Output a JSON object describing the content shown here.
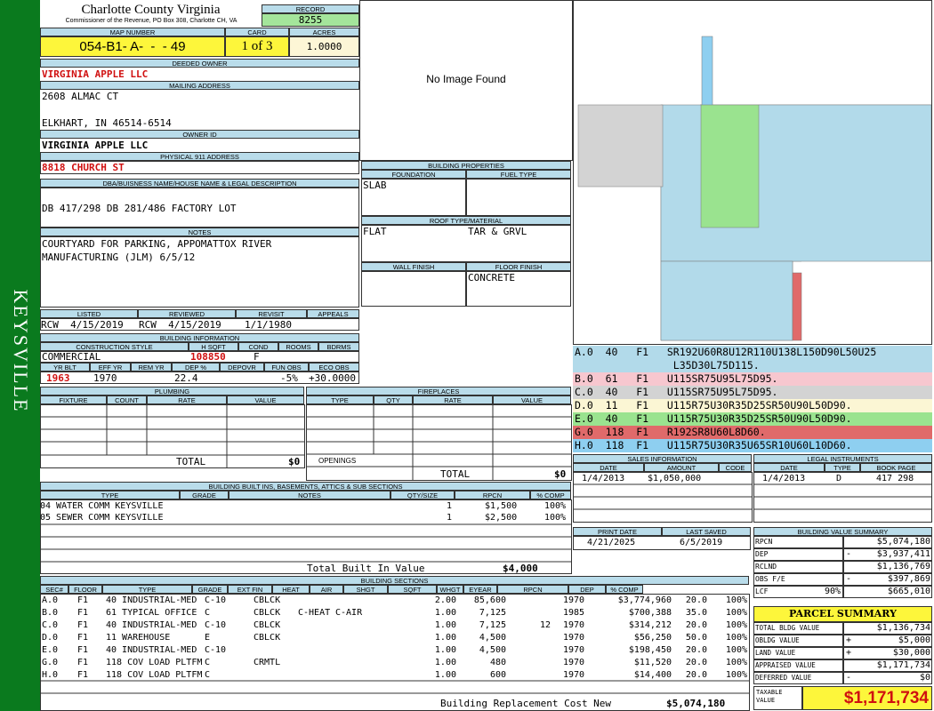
{
  "sidebar": {
    "label": "KEYSVILLE"
  },
  "header": {
    "county": "Charlotte County Virginia",
    "subtitle": "Commissioner of the Revenue, PO Box 308, Charlotte CH, VA",
    "record_label": "RECORD",
    "record": "8255",
    "map_label": "MAP NUMBER",
    "map": "054-B1- A-  -  - 49",
    "card_label": "CARD",
    "card": "1 of 3",
    "acres_label": "ACRES",
    "acres": "1.0000"
  },
  "owner": {
    "deeded_label": "DEEDED OWNER",
    "deeded": "VIRGINIA APPLE LLC",
    "mailing_label": "MAILING ADDRESS",
    "addr1": "2608 ALMAC CT",
    "addr2": "ELKHART, IN 46514-6514",
    "owner_id_label": "OWNER ID",
    "owner_id": "VIRGINIA APPLE LLC",
    "phys_label": "PHYSICAL 911 ADDRESS",
    "phys": "8818 CHURCH ST"
  },
  "legal": {
    "label": "DBA/BUISNESS NAME/HOUSE NAME & LEGAL DESCRIPTION",
    "text": "DB 417/298 DB 281/486 FACTORY LOT",
    "notes_label": "NOTES",
    "notes1": "COURTYARD FOR PARKING, APPOMATTOX RIVER",
    "notes2": "MANUFACTURING (JLM) 6/5/12"
  },
  "photo": {
    "text": "No Image Found"
  },
  "bprops": {
    "label": "BUILDING PROPERTIES",
    "foundation_label": "FOUNDATION",
    "fuel_label": "FUEL TYPE",
    "foundation": "SLAB",
    "roof_label": "ROOF TYPE/MATERIAL",
    "roof1": "FLAT",
    "roof2": "TAR & GRVL",
    "wall_label": "WALL FINISH",
    "floor_label": "FLOOR FINISH",
    "floor": "CONCRETE"
  },
  "dates": {
    "listed_label": "LISTED",
    "reviewed_label": "REVIEWED",
    "revisit_label": "REVISIT",
    "appeals_label": "APPEALS",
    "listed": "RCW  4/15/2019",
    "reviewed": "RCW  4/15/2019",
    "revisit": "1/1/1980"
  },
  "binfo": {
    "label": "BUILDING INFORMATION",
    "cs_label": "CONSTRUCTION STYLE",
    "hsqft_label": "H SQFT",
    "cond_label": "COND",
    "rooms_label": "ROOMS",
    "bdrms_label": "BDRMS",
    "cs": "COMMERCIAL",
    "hsqft": "108850",
    "cond": "F",
    "yrblt_label": "YR BLT",
    "effyr_label": "EFF YR",
    "remyr_label": "REM YR",
    "dep_label": "DEP %",
    "depovr_label": "DEPOVR",
    "funobs_label": "FUN OBS",
    "ecoobs_label": "ECO OBS",
    "yrblt": "1963",
    "effyr": "1970",
    "dep": "22.4",
    "funobs": "-5%",
    "ecoobs": "+30.0000"
  },
  "plumbing": {
    "label": "PLUMBING",
    "cols": [
      "FIXTURE",
      "COUNT",
      "RATE",
      "VALUE"
    ],
    "total_label": "TOTAL",
    "total": "$0"
  },
  "fireplaces": {
    "label": "FIREPLACES",
    "cols": [
      "TYPE",
      "QTY",
      "RATE",
      "VALUE"
    ],
    "openings": "OPENINGS",
    "total_label": "TOTAL",
    "total": "$0"
  },
  "builtins": {
    "label": "BUILDING BUILT INS, BASEMENTS, ATTICS & SUB SECTIONS",
    "cols": [
      "TYPE",
      "GRADE",
      "NOTES",
      "QTY/SIZE",
      "RPCN",
      "% COMP"
    ],
    "rows": [
      [
        "04 WATER COMM KEYSVILLE",
        "1",
        "$1,500",
        "100%"
      ],
      [
        "05 SEWER COMM KEYSVILLE",
        "1",
        "$2,500",
        "100%"
      ]
    ],
    "total_label": "Total Built In Value",
    "total": "$4,000"
  },
  "sections": {
    "label": "BUILDING SECTIONS",
    "cols": [
      "SEC#",
      "FLOOR",
      "TYPE",
      "GRADE",
      "EXT FIN",
      "HEAT",
      "AIR",
      "SHGT",
      "SQFT",
      "WHGT",
      "EYEAR",
      "RPCN",
      "DEP",
      "% COMP"
    ],
    "rows": [
      [
        "A.0",
        "F1",
        "40 INDUSTRIAL-MED",
        "C-10",
        "CBLCK",
        "",
        "",
        "2.00",
        "85,600",
        "",
        "1970",
        "$3,774,960",
        "20.0",
        "100%"
      ],
      [
        "B.0",
        "F1",
        "61 TYPICAL OFFICE",
        "C",
        "CBLCK",
        "C-HEAT",
        "C-AIR",
        "1.00",
        "7,125",
        "",
        "1985",
        "$700,388",
        "35.0",
        "100%"
      ],
      [
        "C.0",
        "F1",
        "40 INDUSTRIAL-MED",
        "C-10",
        "CBLCK",
        "",
        "",
        "1.00",
        "7,125",
        "12",
        "1970",
        "$314,212",
        "20.0",
        "100%"
      ],
      [
        "D.0",
        "F1",
        "11 WAREHOUSE",
        "E",
        "CBLCK",
        "",
        "",
        "1.00",
        "4,500",
        "",
        "1970",
        "$56,250",
        "50.0",
        "100%"
      ],
      [
        "E.0",
        "F1",
        "40 INDUSTRIAL-MED",
        "C-10",
        "",
        "",
        "",
        "1.00",
        "4,500",
        "",
        "1970",
        "$198,450",
        "20.0",
        "100%"
      ],
      [
        "G.0",
        "F1",
        "118 COV LOAD PLTFM",
        "C",
        "CRMTL",
        "",
        "",
        "1.00",
        "480",
        "",
        "1970",
        "$11,520",
        "20.0",
        "100%"
      ],
      [
        "H.0",
        "F1",
        "118 COV LOAD PLTFM",
        "C",
        "",
        "",
        "",
        "1.00",
        "600",
        "",
        "1970",
        "$14,400",
        "20.0",
        "100%"
      ]
    ],
    "total_label": "Building Replacement Cost New",
    "total": "$5,074,180"
  },
  "sketch": {
    "codes": [
      {
        "line": "A.0  40   F1   SR192U60R8U12R110U138L150D90L50U25",
        "color": "#b2daea"
      },
      {
        "line": "                L35D30L75D115.",
        "color": "#b2daea"
      },
      {
        "line": "B.0  61   F1   U115SR75U95L75D95.",
        "color": "#f7c7cf"
      },
      {
        "line": "C.0  40   F1   U115SR75U95L75D95.",
        "color": "#d3d3d3"
      },
      {
        "line": "D.0  11   F1   U115R75U30R35D25SR50U90L50D90.",
        "color": "#fbf6d4"
      },
      {
        "line": "E.0  40   F1   U115R75U30R35D25SR50U90L50D90.",
        "color": "#9ae38f"
      },
      {
        "line": "G.0  118  F1   R192SR8U60L8D60.",
        "color": "#e06a6a"
      },
      {
        "line": "H.0  118  F1   U115R75U30R35U65SR10U60L10D60.",
        "color": "#8ecff0"
      }
    ]
  },
  "sales": {
    "label": "SALES INFORMATION",
    "cols": [
      "DATE",
      "AMOUNT",
      "CODE"
    ],
    "date": "1/4/2013",
    "amount": "$1,050,000"
  },
  "legalinst": {
    "label": "LEGAL INSTRUMENTS",
    "cols": [
      "DATE",
      "TYPE",
      "BOOK PAGE"
    ],
    "date": "1/4/2013",
    "type": "D",
    "book": "417 298"
  },
  "print": {
    "print_label": "PRINT DATE",
    "saved_label": "LAST SAVED",
    "print": "4/21/2025",
    "saved": "6/5/2019"
  },
  "bvs": {
    "label": "BUILDING VALUE SUMMARY",
    "rows": [
      [
        "RPCN",
        "",
        "$5,074,180"
      ],
      [
        "DEP",
        "-",
        "$3,937,411"
      ],
      [
        "RCLND",
        "",
        "$1,136,769"
      ],
      [
        "OBS F/E",
        "-",
        "$397,869"
      ],
      [
        "LCF",
        "90%",
        "$665,010"
      ]
    ]
  },
  "parcel": {
    "label": "PARCEL SUMMARY",
    "rows": [
      [
        "TOTAL BLDG VALUE",
        "",
        "$1,136,734"
      ],
      [
        "OBLDG VALUE",
        "+",
        "$5,000"
      ],
      [
        "LAND VALUE",
        "+",
        "$30,000"
      ],
      [
        "APPRAISED VALUE",
        "",
        "$1,171,734"
      ],
      [
        "DEFERRED VALUE",
        "-",
        "$0"
      ]
    ],
    "taxable_label": "TAXABLE VALUE",
    "taxable": "$1,171,734"
  }
}
